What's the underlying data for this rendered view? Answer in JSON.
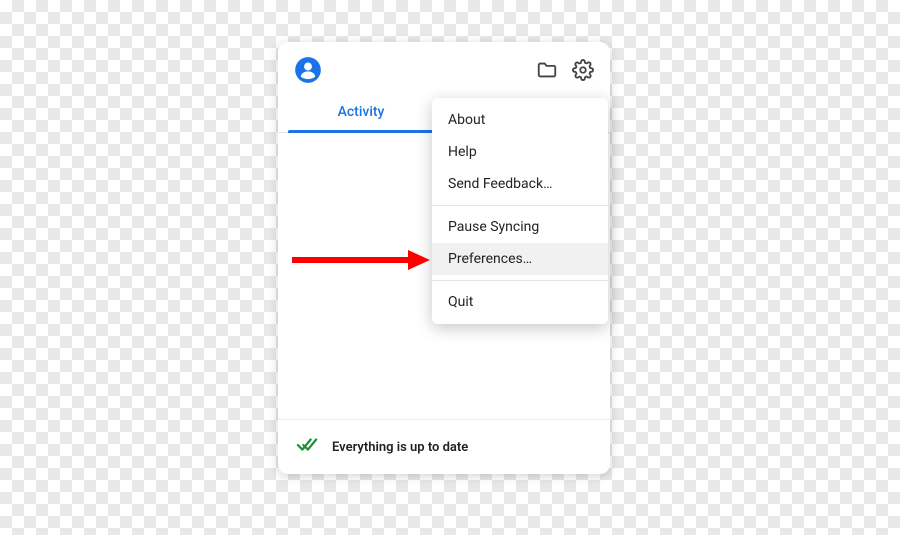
{
  "tabs": {
    "activity_label": "Activity"
  },
  "menu": {
    "about": "About",
    "help": "Help",
    "feedback": "Send Feedback…",
    "pause": "Pause Syncing",
    "preferences": "Preferences…",
    "quit": "Quit"
  },
  "footer": {
    "status": "Everything is up to date"
  },
  "colors": {
    "accent": "#1a73e8",
    "check": "#1e8e3e",
    "arrow": "#ff0000"
  }
}
